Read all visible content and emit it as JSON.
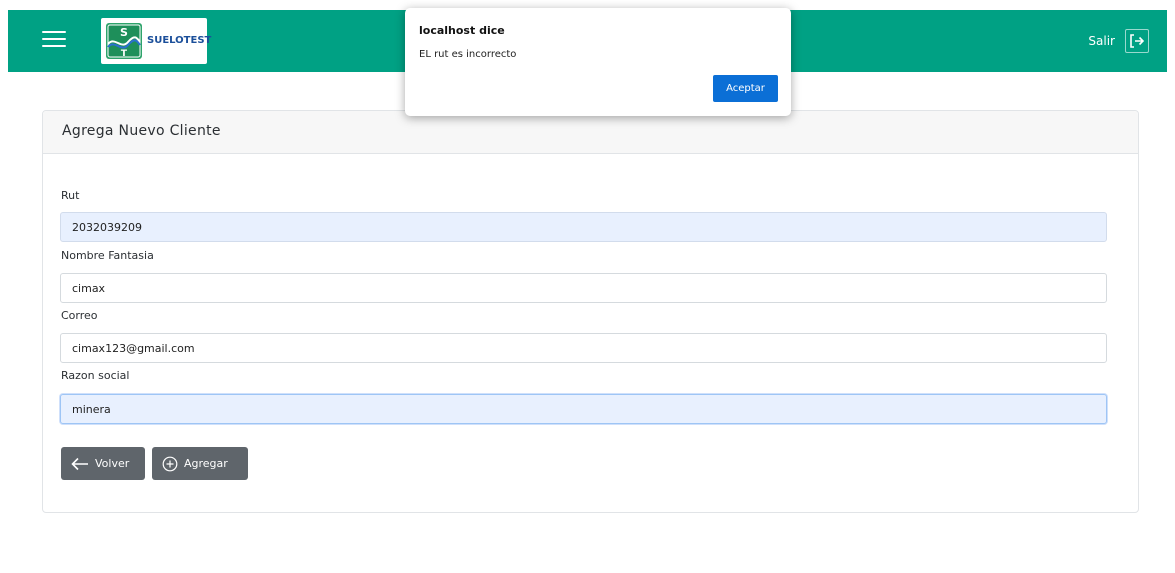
{
  "navbar": {
    "bg_color": "#00a184",
    "menu_icon": "hamburger-menu-icon",
    "logo": {
      "letters": "S T",
      "name": "SUELOTEST",
      "tagline": ""
    },
    "logout_label": "Salir",
    "logout_icon": "logout-arrow-icon"
  },
  "dialog": {
    "title": "localhost dice",
    "message": "EL rut es incorrecto",
    "ok_label": "Aceptar",
    "ok_color": "#0b6fd6"
  },
  "form": {
    "title": "Agrega Nuevo Cliente",
    "fields": [
      {
        "label": "Rut",
        "value": "2032039209"
      },
      {
        "label": "Nombre Fantasia",
        "value": "cimax"
      },
      {
        "label": "Correo",
        "value": "cimax123@gmail.com"
      },
      {
        "label": "Razon social",
        "value": "minera"
      }
    ],
    "back_label": "Volver",
    "back_icon": "arrow-left-icon",
    "add_label": "Agregar",
    "add_icon": "plus-circle-icon",
    "button_color": "#5f656b"
  }
}
